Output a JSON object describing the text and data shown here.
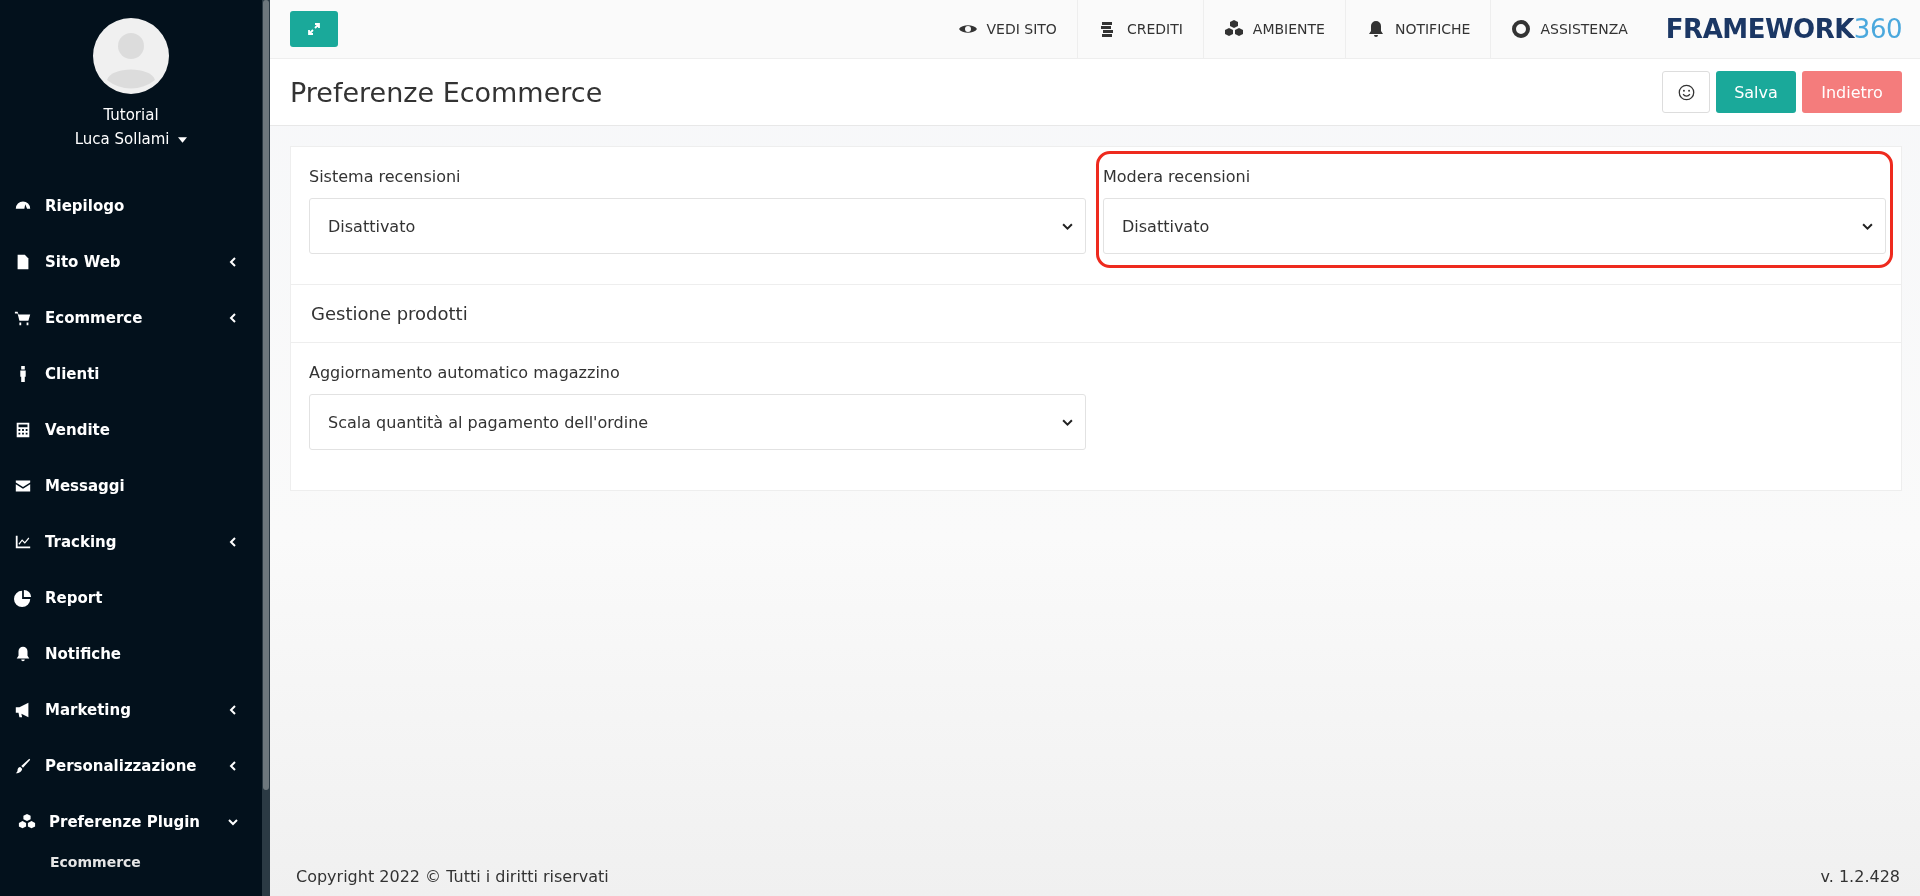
{
  "user": {
    "group": "Tutorial",
    "name": "Luca Sollami"
  },
  "sidebar": {
    "items": [
      {
        "label": "Riepilogo",
        "has_submenu": false,
        "expanded": false
      },
      {
        "label": "Sito Web",
        "has_submenu": true,
        "expanded": false
      },
      {
        "label": "Ecommerce",
        "has_submenu": true,
        "expanded": false
      },
      {
        "label": "Clienti",
        "has_submenu": false,
        "expanded": false
      },
      {
        "label": "Vendite",
        "has_submenu": false,
        "expanded": false
      },
      {
        "label": "Messaggi",
        "has_submenu": false,
        "expanded": false
      },
      {
        "label": "Tracking",
        "has_submenu": true,
        "expanded": false
      },
      {
        "label": "Report",
        "has_submenu": false,
        "expanded": false
      },
      {
        "label": "Notifiche",
        "has_submenu": false,
        "expanded": false
      },
      {
        "label": "Marketing",
        "has_submenu": true,
        "expanded": false
      },
      {
        "label": "Personalizzazione",
        "has_submenu": true,
        "expanded": false
      },
      {
        "label": "Preferenze Plugin",
        "has_submenu": true,
        "expanded": true,
        "children": [
          {
            "label": "Ecommerce"
          }
        ]
      }
    ]
  },
  "topbar": {
    "nav": [
      "VEDI SITO",
      "CREDITI",
      "AMBIENTE",
      "NOTIFICHE",
      "ASSISTENZA"
    ],
    "logo": {
      "text": "FRAMEWORK",
      "number": "360"
    }
  },
  "page": {
    "title": "Preferenze Ecommerce",
    "buttons": [
      {
        "label": "Salva",
        "kind": "save"
      },
      {
        "label": "Indietro",
        "kind": "back"
      }
    ]
  },
  "sections": [
    {
      "fields": [
        {
          "label": "Sistema recensioni",
          "value": "Disattivato",
          "highlighted": false
        },
        {
          "label": "Modera recensioni",
          "value": "Disattivato",
          "highlighted": true
        }
      ]
    },
    {
      "title": "Gestione prodotti",
      "fields": [
        {
          "label": "Aggiornamento automatico magazzino",
          "value": "Scala quantità al pagamento dell'ordine",
          "highlighted": false
        }
      ]
    }
  ],
  "footer": {
    "copyright": "Copyright 2022 © Tutti i diritti riservati",
    "version": "v. 1.2.428"
  }
}
